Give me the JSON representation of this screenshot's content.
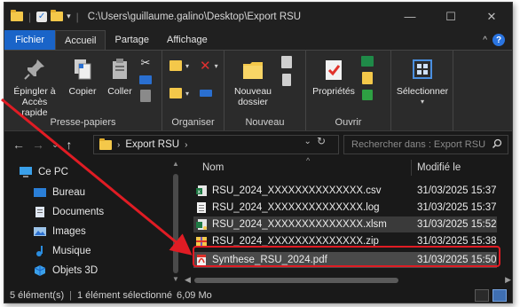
{
  "window": {
    "title_path": "C:\\Users\\guillaume.galino\\Desktop\\Export RSU",
    "controls": {
      "minimize": "—",
      "maximize": "☐",
      "close": "✕"
    }
  },
  "menu": {
    "tabs": [
      {
        "label": "Fichier"
      },
      {
        "label": "Accueil"
      },
      {
        "label": "Partage"
      },
      {
        "label": "Affichage"
      }
    ],
    "expand_caret": "^",
    "help": "?"
  },
  "ribbon": {
    "clipboard": {
      "pin_line1": "Épingler à",
      "pin_line2": "Accès rapide",
      "copy": "Copier",
      "paste": "Coller",
      "group": "Presse-papiers"
    },
    "organize": {
      "group": "Organiser"
    },
    "new": {
      "new_folder_line1": "Nouveau",
      "new_folder_line2": "dossier",
      "group": "Nouveau"
    },
    "open": {
      "properties": "Propriétés",
      "group": "Ouvrir"
    },
    "select": {
      "selection": "Sélectionner"
    }
  },
  "address": {
    "back": "←",
    "forward": "→",
    "recent": "⌄",
    "up": "↑",
    "folder": "Export RSU",
    "search_placeholder": "Rechercher dans : Export RSU"
  },
  "nav_pane": {
    "items": [
      {
        "label": "Ce PC",
        "icon": "pc-icon"
      },
      {
        "label": "Bureau",
        "icon": "desktop-icon"
      },
      {
        "label": "Documents",
        "icon": "documents-icon"
      },
      {
        "label": "Images",
        "icon": "images-icon"
      },
      {
        "label": "Musique",
        "icon": "music-icon"
      },
      {
        "label": "Objets 3D",
        "icon": "objects3d-icon"
      }
    ]
  },
  "file_list": {
    "columns": {
      "name": "Nom",
      "modified": "Modifié le"
    },
    "rows": [
      {
        "name": "RSU_2024_XXXXXXXXXXXXXX.csv",
        "modified": "31/03/2025 15:37",
        "icon": "excel-csv-icon"
      },
      {
        "name": "RSU_2024_XXXXXXXXXXXXXX.log",
        "modified": "31/03/2025 15:37",
        "icon": "text-file-icon"
      },
      {
        "name": "RSU_2024_XXXXXXXXXXXXXX.xlsm",
        "modified": "31/03/2025 15:52",
        "icon": "excel-macro-icon"
      },
      {
        "name": "RSU_2024_XXXXXXXXXXXXXX.zip",
        "modified": "31/03/2025 15:38",
        "icon": "zip-archive-icon"
      },
      {
        "name": "Synthese_RSU_2024.pdf",
        "modified": "31/03/2025 15:50",
        "icon": "pdf-file-icon"
      }
    ]
  },
  "status_bar": {
    "count": "5 élément(s)",
    "selection": "1 élément sélectionné",
    "size": "6,09 Mo"
  },
  "colors": {
    "accent": "#1a64c8",
    "highlight_box": "#e01c24",
    "background": "#191919"
  }
}
